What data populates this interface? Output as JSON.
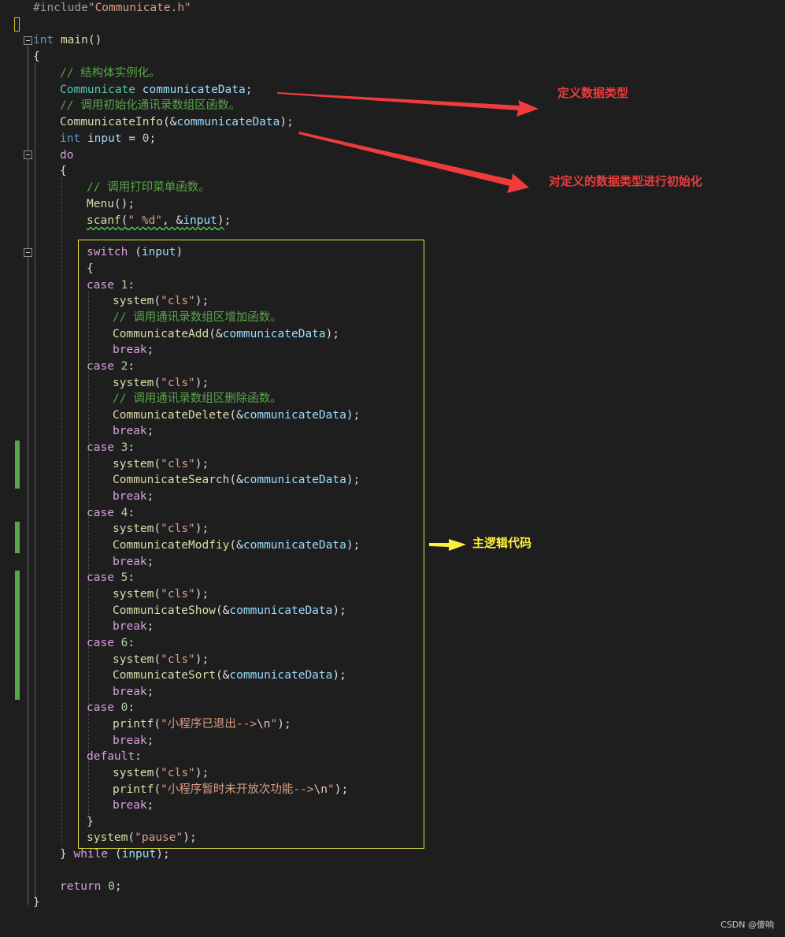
{
  "code": {
    "include_directive": "#include",
    "include_file": "\"Communicate.h\"",
    "main_type": "int",
    "main_name": "main",
    "main_parens": "()",
    "open_brace": "{",
    "close_brace": "}",
    "comment_struct": "// 结构体实例化。",
    "type_communicate": "Communicate",
    "var_data": "communicateData",
    "semicolon": ";",
    "comment_init": "// 调用初始化通讯录数组区函数。",
    "fn_info": "CommunicateInfo",
    "amp_open": "(&",
    "close_semi": ");",
    "int_kw": "int",
    "var_input": "input",
    "assign": " = ",
    "zero": "0",
    "do_kw": "do",
    "comment_menu": "// 调用打印菜单函数。",
    "fn_menu": "Menu",
    "call_empty": "();",
    "fn_scanf": "scanf",
    "paren_open": "(",
    "fmt_d": "\" %d\"",
    "comma_amp": ", &",
    "switch_kw": "switch",
    "switch_cond_open": " (",
    "paren_close": ")",
    "case_kw": "case",
    "colon": ":",
    "case_1": "1",
    "case_2": "2",
    "case_3": "3",
    "case_4": "4",
    "case_5": "5",
    "case_6": "6",
    "case_0": "0",
    "fn_system": "system",
    "str_cls": "\"cls\"",
    "comment_add": "// 调用通讯录数组区增加函数。",
    "fn_add": "CommunicateAdd",
    "break_kw": "break",
    "comment_delete": "// 调用通讯录数组区删除函数。",
    "fn_delete": "CommunicateDelete",
    "fn_search": "CommunicateSearch",
    "fn_modify": "CommunicateModfiy",
    "fn_show": "CommunicateShow",
    "fn_sort": "CommunicateSort",
    "fn_printf": "printf",
    "str_exit_text": "\"小程序已退出-->",
    "str_exit_esc": "\\n",
    "str_quote": "\"",
    "default_kw": "default",
    "str_noopen_text": "\"小程序暂时未开放次功能-->",
    "str_pause": "\"pause\"",
    "while_kw": "while",
    "while_cond": " (",
    "while_close": ");",
    "return_kw": "return",
    "space": " "
  },
  "annotations": {
    "define_type": "定义数据类型",
    "init_type": "对定义的数据类型进行初始化",
    "main_logic": "主逻辑代码"
  },
  "watermark": "CSDN @傻响",
  "colors": {
    "background": "#1e1e1e",
    "keyword": "#569cd6",
    "control_flow": "#d8a0df",
    "function": "#dcdcaa",
    "variable": "#9cdcfe",
    "type": "#4ec9b0",
    "string": "#d69d85",
    "comment": "#57a64a",
    "annotation_red": "#ef3b3b",
    "annotation_yellow": "#fff13b",
    "highlight_box": "#e5e53c",
    "change_bar": "#57a64a"
  }
}
